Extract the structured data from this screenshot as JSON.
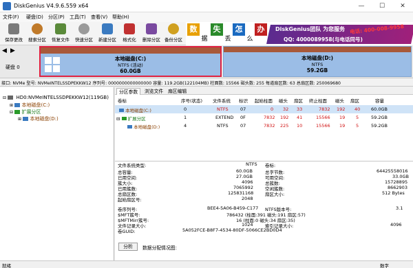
{
  "window": {
    "title": "DiskGenius V4.9.6.559 x64",
    "controls": [
      "—",
      "☐",
      "✕"
    ]
  },
  "menu": [
    "文件(F)",
    "硬盘(D)",
    "分区(P)",
    "工具(T)",
    "查看(V)",
    "帮助(H)"
  ],
  "toolbar": [
    {
      "label": "保存更改",
      "icon": "save-icon",
      "color": "#7a7a7a"
    },
    {
      "label": "搜索分区",
      "icon": "search-icon",
      "color": "#c07a2a"
    },
    {
      "label": "恢复文件",
      "icon": "recover-icon",
      "color": "#5a8a3a"
    },
    {
      "label": "快速分区",
      "icon": "quick-partition-icon",
      "color": "#9a9a9a"
    },
    {
      "label": "新建分区",
      "icon": "new-partition-icon",
      "color": "#3a7ac0"
    },
    {
      "label": "格式化",
      "icon": "format-icon",
      "color": "#c03030"
    },
    {
      "label": "删除分区",
      "icon": "delete-icon",
      "color": "#7a4aa0"
    },
    {
      "label": "备份分区",
      "icon": "backup-icon",
      "color": "#d0a020"
    }
  ],
  "banner": {
    "chars": [
      {
        "char": "数",
        "color": "#e8a000"
      },
      {
        "char": "失",
        "color": "#2a8a2a"
      },
      {
        "char": "怎",
        "color": "#1a6ac0"
      },
      {
        "char": "办",
        "color": "#c02020"
      }
    ],
    "sub_chars": [
      "据",
      "丢",
      "么"
    ],
    "brand": "DiskGenius团队 为您服务",
    "phone": "电话: 400-008-9958",
    "qq": "QQ: 4000089958(与电话同号)"
  },
  "diskbar": {
    "label": "硬盘 0",
    "partitions": [
      {
        "name": "本地磁盘(C:)",
        "fs": "NTFS (活动)",
        "size": "60.0GB"
      },
      {
        "name": "本地磁盘(D:)",
        "fs": "NTFS",
        "size": "59.2GB"
      }
    ]
  },
  "infoline": {
    "text": "接口: NVMe  型号: NVMeINTELSSDPEKKW12  序列号: 0000000000000000  容量: 119.2GB(122104MB)  柱面数: 15566  磁头数: 255  每道扇区数: 63  总扇区数: 250069680"
  },
  "tree": {
    "disk": "HD0:NVMeINTELSSDPEKKW12(119GB)",
    "items": [
      {
        "label": "本地磁盘(C:)",
        "color": "#8b4000"
      },
      {
        "label": "扩展分区",
        "color": "#1a7a1a"
      },
      {
        "label": "本地磁盘(D:)",
        "color": "#8b4000"
      }
    ]
  },
  "tabs": [
    "分区参数",
    "浏览文件",
    "扇区编辑"
  ],
  "table": {
    "headers": [
      "卷标",
      "序号(状态)",
      "文件系统",
      "标识",
      "起始柱面",
      "磁头",
      "扇区",
      "终止柱面",
      "磁头",
      "扇区",
      "容量"
    ],
    "rows": [
      {
        "label": "本地磁盘(C:)",
        "cells": [
          "0",
          "NTFS",
          "07",
          "0",
          "32",
          "33",
          "7832",
          "192",
          "40",
          "60.0GB"
        ]
      },
      {
        "label": "扩展分区",
        "cells": [
          "1",
          "EXTEND",
          "0F",
          "7832",
          "192",
          "41",
          "15566",
          "19",
          "5",
          "59.2GB"
        ]
      },
      {
        "label": "本地磁盘(D:)",
        "cells": [
          "4",
          "NTFS",
          "07",
          "7832",
          "225",
          "10",
          "15566",
          "19",
          "5",
          "59.2GB"
        ]
      }
    ]
  },
  "details": {
    "fs_type_label": "文件系统类型:",
    "fs_type": "NTFS",
    "vol_label": "卷标:",
    "left": [
      {
        "k": "总容量:",
        "v": "60.0GB"
      },
      {
        "k": "已用空间:",
        "v": "27.0GB"
      },
      {
        "k": "簇大小:",
        "v": "4096"
      },
      {
        "k": "已用簇数:",
        "v": "7065992"
      },
      {
        "k": "总扇区数:",
        "v": "125831168"
      },
      {
        "k": "起始扇区号:",
        "v": "2048"
      }
    ],
    "right": [
      {
        "k": "总字节数:",
        "v": "64425558016"
      },
      {
        "k": "可用空间:",
        "v": "33.0GB"
      },
      {
        "k": "总簇数:",
        "v": "15728895"
      },
      {
        "k": "空闲簇数:",
        "v": "8662903"
      },
      {
        "k": "扇区大小:",
        "v": "512 Bytes"
      }
    ],
    "extra": [
      {
        "k": "卷序列号:",
        "v": "BEE4-5A06-B459-C177",
        "k2": "NTFS版本号:",
        "v2": "3.1"
      },
      {
        "k": "$MFT簇号:",
        "v": "786432 (柱面:391 磁头:191 扇区:57)"
      },
      {
        "k": "$MFTMirr簇号:",
        "v": "16 (柱面:0 磁头:34 扇区:35)"
      },
      {
        "k": "文件记录大小:",
        "v": "1024",
        "k2": "索引记录大小:",
        "v2": "4096"
      },
      {
        "k": "卷GUID:",
        "v": "5A052FCE-B8F7-4534-80DF-5066CE2BD0D4"
      }
    ],
    "analyze_button": "分析",
    "analyze_label": "数据分配情况图:"
  },
  "status": {
    "left": "就绪",
    "right": "数字"
  }
}
